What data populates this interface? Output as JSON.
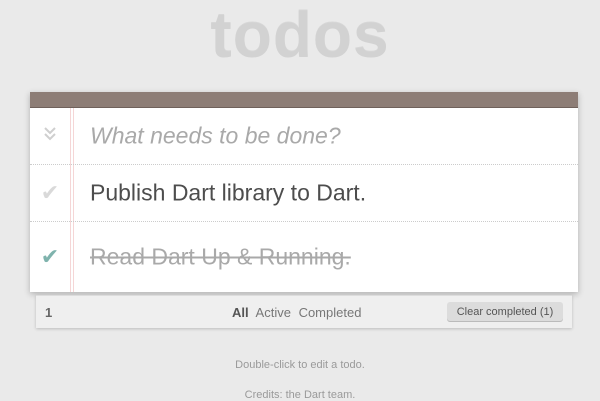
{
  "app": {
    "title": "todos"
  },
  "new_todo": {
    "placeholder": "What needs to be done?",
    "toggle_all_icon": "double-chevron-down-icon"
  },
  "todos": [
    {
      "text": "Publish Dart library to Dart.",
      "completed": false,
      "icon": "check-icon"
    },
    {
      "text": "Read Dart Up & Running.",
      "completed": true,
      "icon": "check-icon"
    }
  ],
  "footer": {
    "count": "1",
    "filters": [
      "All",
      "Active",
      "Completed"
    ],
    "selected_filter": "All",
    "clear_label": "Clear completed (1)"
  },
  "info": {
    "edit_hint": "Double-click to edit a todo.",
    "credits": "Credits: the Dart team."
  },
  "colors": {
    "header_bar": "#8d7d76",
    "completed_check": "#7fb3ad",
    "title": "#d2d2d2"
  }
}
